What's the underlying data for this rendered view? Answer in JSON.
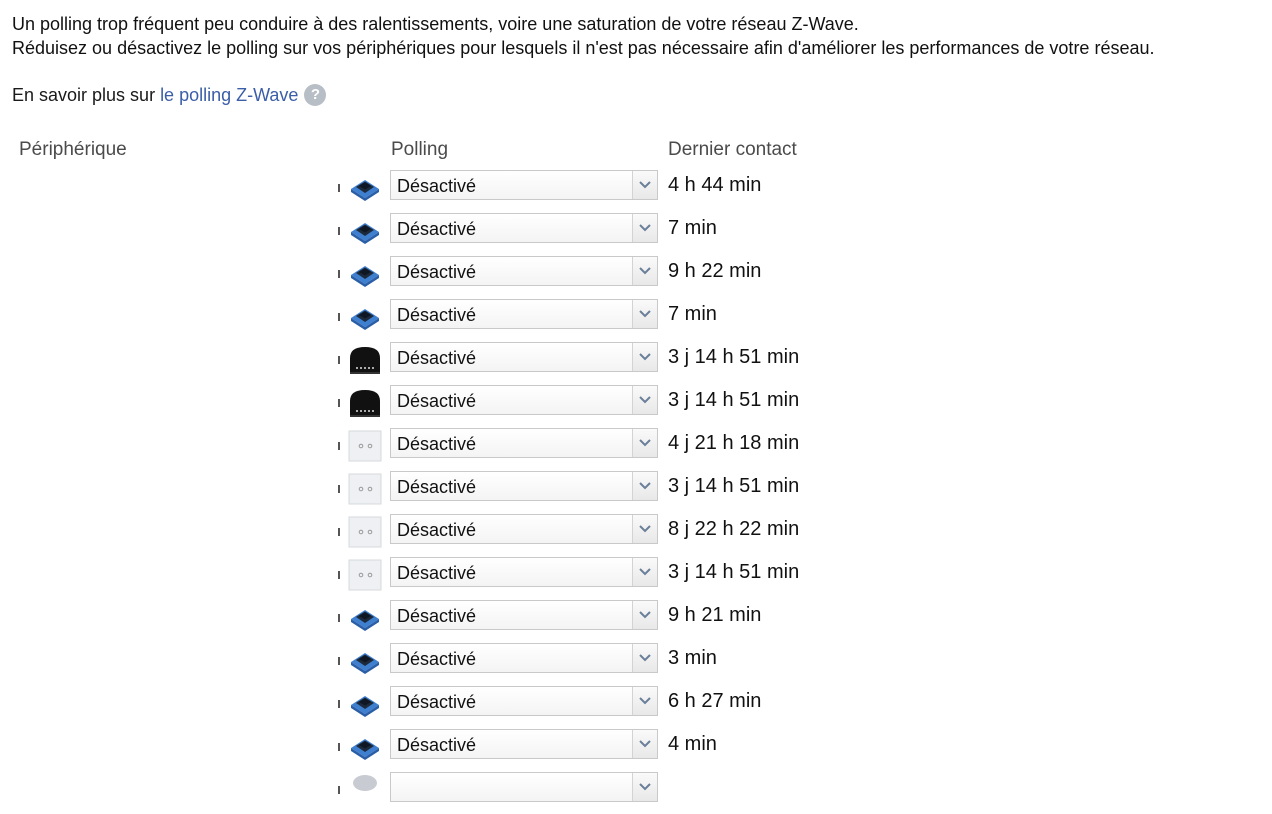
{
  "intro": {
    "line1": "Un polling trop fréquent peu conduire à des ralentissements, voire une saturation de votre réseau Z-Wave.",
    "line2": "Réduisez ou désactivez le polling sur vos périphériques pour lesquels il n'est pas nécessaire afin d'améliorer les performances de votre réseau."
  },
  "learn": {
    "prefix": "En savoir plus sur",
    "link": "le polling Z-Wave",
    "help_icon": "?"
  },
  "table": {
    "headers": {
      "device": "Périphérique",
      "polling": "Polling",
      "last_contact": "Dernier contact"
    },
    "rows": [
      {
        "icon": "blue-module-icon",
        "polling": "Désactivé",
        "last_contact": "4 h 44 min"
      },
      {
        "icon": "blue-module-icon",
        "polling": "Désactivé",
        "last_contact": "7 min"
      },
      {
        "icon": "blue-module-icon",
        "polling": "Désactivé",
        "last_contact": "9 h 22 min"
      },
      {
        "icon": "blue-module-icon",
        "polling": "Désactivé",
        "last_contact": "7 min"
      },
      {
        "icon": "black-module-icon",
        "polling": "Désactivé",
        "last_contact": "3 j 14 h 51 min"
      },
      {
        "icon": "black-module-icon",
        "polling": "Désactivé",
        "last_contact": "3 j 14 h 51 min"
      },
      {
        "icon": "wall-switch-icon",
        "polling": "Désactivé",
        "last_contact": "4 j 21 h 18 min"
      },
      {
        "icon": "wall-switch-icon",
        "polling": "Désactivé",
        "last_contact": "3 j 14 h 51 min"
      },
      {
        "icon": "wall-switch-icon",
        "polling": "Désactivé",
        "last_contact": "8 j 22 h 22 min"
      },
      {
        "icon": "wall-switch-icon",
        "polling": "Désactivé",
        "last_contact": "3 j 14 h 51 min"
      },
      {
        "icon": "blue-module-icon",
        "polling": "Désactivé",
        "last_contact": "9 h 21 min"
      },
      {
        "icon": "blue-module-icon",
        "polling": "Désactivé",
        "last_contact": "3 min"
      },
      {
        "icon": "blue-module-icon",
        "polling": "Désactivé",
        "last_contact": "6 h 27 min"
      },
      {
        "icon": "blue-module-icon",
        "polling": "Désactivé",
        "last_contact": "4 min"
      },
      {
        "icon": "round-sensor-icon",
        "polling": "",
        "last_contact": ""
      }
    ]
  },
  "colors": {
    "link": "#3a5ea8",
    "header_text": "#4b4b4b",
    "module_blue": "#3f7fd0"
  }
}
